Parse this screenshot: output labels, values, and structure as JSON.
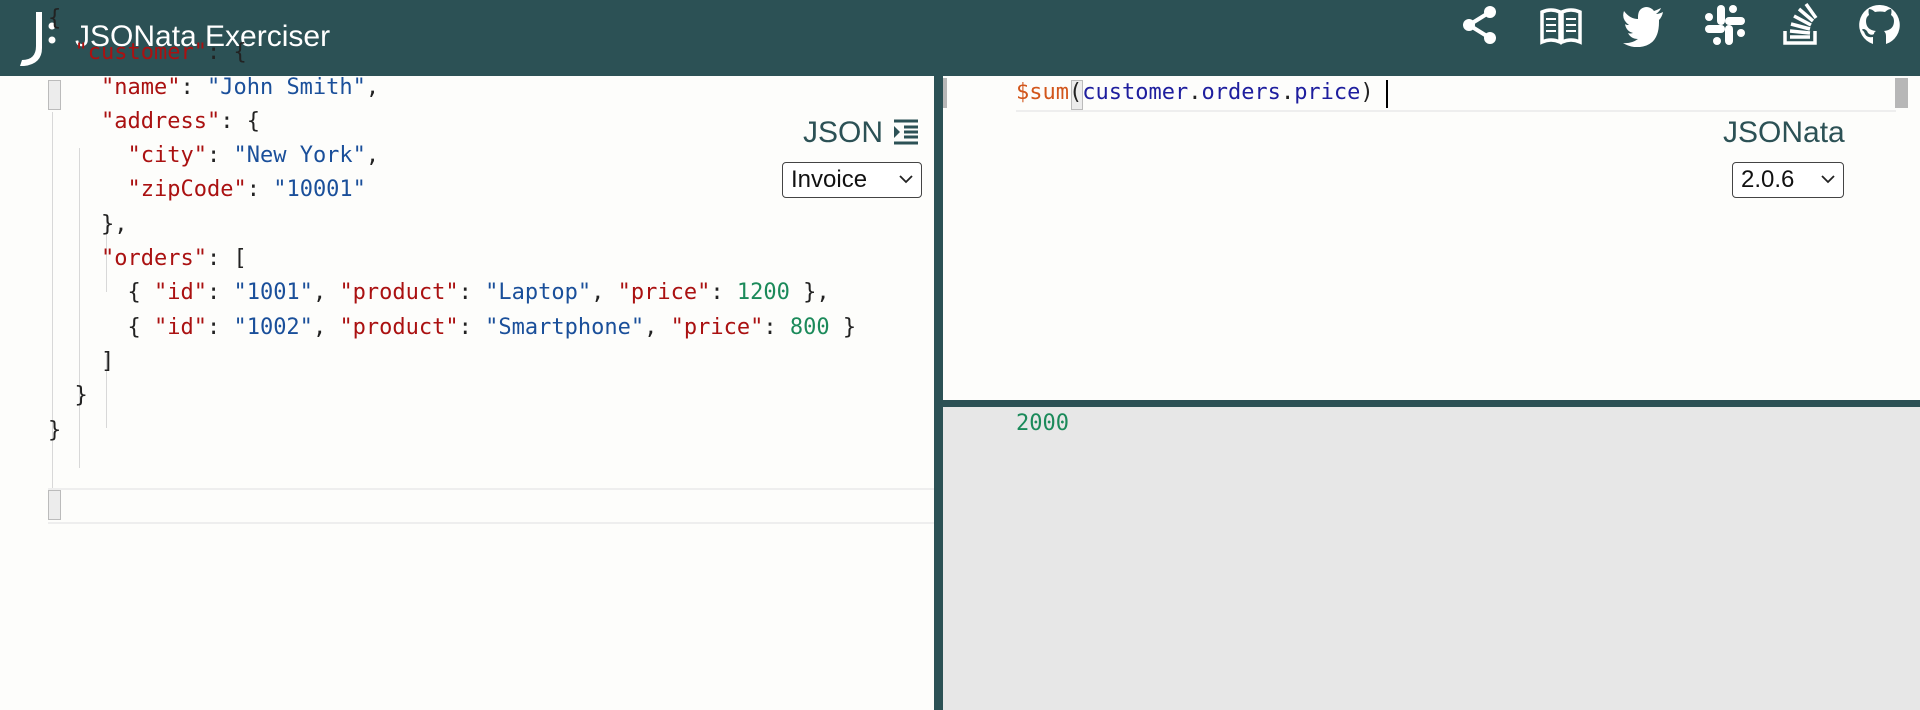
{
  "header": {
    "title": "JSONata Exerciser",
    "icons": [
      "share-icon",
      "docs-book-icon",
      "twitter-icon",
      "slack-icon",
      "stackoverflow-icon",
      "github-icon"
    ]
  },
  "input_pane": {
    "label": "JSON",
    "sample_select": {
      "selected": "Invoice"
    },
    "lines": [
      [
        [
          "p",
          "{"
        ]
      ],
      [
        [
          "p",
          "  "
        ],
        [
          "k",
          "\"customer\""
        ],
        [
          "p",
          ": {"
        ]
      ],
      [
        [
          "p",
          "    "
        ],
        [
          "k",
          "\"name\""
        ],
        [
          "p",
          ": "
        ],
        [
          "s",
          "\"John Smith\""
        ],
        [
          "p",
          ","
        ]
      ],
      [
        [
          "p",
          "    "
        ],
        [
          "k",
          "\"address\""
        ],
        [
          "p",
          ": {"
        ]
      ],
      [
        [
          "p",
          "      "
        ],
        [
          "k",
          "\"city\""
        ],
        [
          "p",
          ": "
        ],
        [
          "s",
          "\"New York\""
        ],
        [
          "p",
          ","
        ]
      ],
      [
        [
          "p",
          "      "
        ],
        [
          "k",
          "\"zipCode\""
        ],
        [
          "p",
          ": "
        ],
        [
          "s",
          "\"10001\""
        ]
      ],
      [
        [
          "p",
          "    },"
        ]
      ],
      [
        [
          "p",
          "    "
        ],
        [
          "k",
          "\"orders\""
        ],
        [
          "p",
          ": ["
        ]
      ],
      [
        [
          "p",
          "      { "
        ],
        [
          "k",
          "\"id\""
        ],
        [
          "p",
          ": "
        ],
        [
          "s",
          "\"1001\""
        ],
        [
          "p",
          ", "
        ],
        [
          "k",
          "\"product\""
        ],
        [
          "p",
          ": "
        ],
        [
          "s",
          "\"Laptop\""
        ],
        [
          "p",
          ", "
        ],
        [
          "k",
          "\"price\""
        ],
        [
          "p",
          ": "
        ],
        [
          "n",
          "1200"
        ],
        [
          "p",
          " },"
        ]
      ],
      [
        [
          "p",
          "      { "
        ],
        [
          "k",
          "\"id\""
        ],
        [
          "p",
          ": "
        ],
        [
          "s",
          "\"1002\""
        ],
        [
          "p",
          ", "
        ],
        [
          "k",
          "\"product\""
        ],
        [
          "p",
          ": "
        ],
        [
          "s",
          "\"Smartphone\""
        ],
        [
          "p",
          ", "
        ],
        [
          "k",
          "\"price\""
        ],
        [
          "p",
          ": "
        ],
        [
          "n",
          "800"
        ],
        [
          "p",
          " }"
        ]
      ],
      [
        [
          "p",
          "    ]"
        ]
      ],
      [
        [
          "p",
          "  }"
        ]
      ],
      [
        [
          "p",
          "}"
        ]
      ]
    ]
  },
  "expression_pane": {
    "label": "JSONata",
    "version_select": {
      "selected": "2.0.6"
    },
    "expression_tokens": [
      [
        "fn",
        "$sum"
      ],
      [
        "p",
        "("
      ],
      [
        "path",
        "customer"
      ],
      [
        "p",
        "."
      ],
      [
        "path",
        "orders"
      ],
      [
        "p",
        "."
      ],
      [
        "path",
        "price"
      ],
      [
        "p",
        ")"
      ]
    ]
  },
  "result_pane": {
    "output": "2000"
  },
  "colors": {
    "header_bg": "#2c5155",
    "key": "#a11111",
    "string": "#1a4f9a",
    "number": "#1b8a5a",
    "function": "#d2561b",
    "result_bg": "#e7e7e7"
  }
}
